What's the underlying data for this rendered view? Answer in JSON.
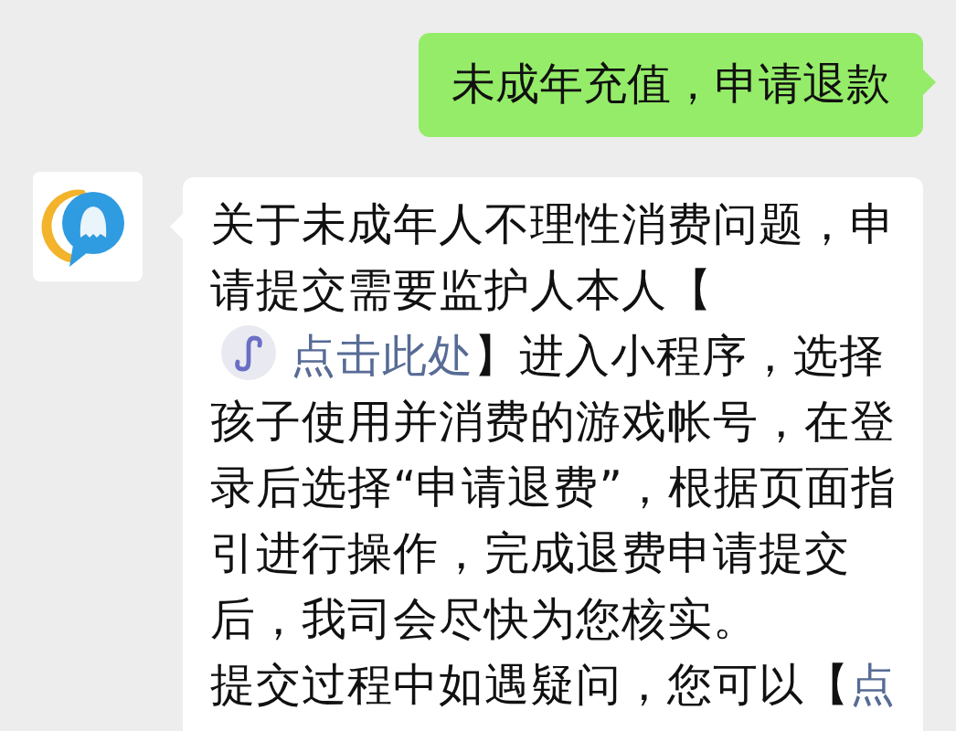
{
  "messages": [
    {
      "kind": "sent",
      "text": "未成年充值，申请退款"
    },
    {
      "kind": "received",
      "paragraphs": [
        {
          "segments": [
            {
              "kind": "text",
              "text": "关于未成年人不理性消费问题，申请提交需要监护人本人【"
            },
            {
              "kind": "link",
              "text": "点击此处",
              "icon": true
            },
            {
              "kind": "text",
              "text": "】进入小程序，选择孩子使用并消费的游戏帐号，在登录后选择“申请退费”，根据页面指引进行操作，完成退费申请提交后，我司会尽快为您核实。"
            }
          ]
        },
        {
          "segments": [
            {
              "kind": "text",
              "text": "提交过程中如遇疑问，您可以【"
            },
            {
              "kind": "link",
              "text": "点"
            }
          ]
        }
      ]
    }
  ]
}
